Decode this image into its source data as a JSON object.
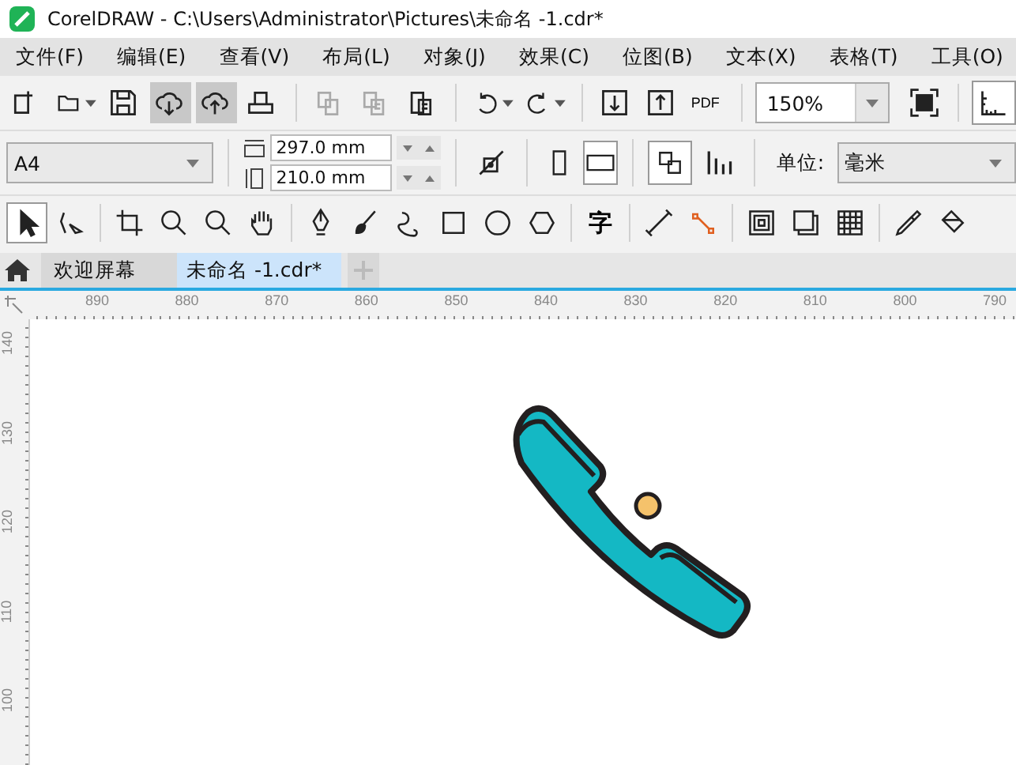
{
  "window": {
    "title": "CorelDRAW - C:\\Users\\Administrator\\Pictures\\未命名 -1.cdr*"
  },
  "menu": [
    "文件(F)",
    "编辑(E)",
    "查看(V)",
    "布局(L)",
    "对象(J)",
    "效果(C)",
    "位图(B)",
    "文本(X)",
    "表格(T)",
    "工具(O)"
  ],
  "standard_toolbar": {
    "buttons": [
      {
        "selected": false,
        "disabled": false
      },
      {
        "selected": false,
        "disabled": false
      },
      {
        "selected": false,
        "disabled": false
      },
      {
        "selected": true,
        "disabled": false
      },
      {
        "selected": true,
        "disabled": false
      },
      {
        "selected": false,
        "disabled": false
      },
      {
        "selected": false,
        "disabled": true
      },
      {
        "selected": false,
        "disabled": true
      },
      {
        "selected": false,
        "disabled": false
      },
      {
        "selected": false,
        "disabled": false
      },
      {
        "selected": false,
        "disabled": false
      },
      {
        "selected": false,
        "disabled": false
      },
      {
        "selected": false,
        "disabled": false
      }
    ],
    "pdf_label": "PDF",
    "zoom": "150%"
  },
  "property_bar": {
    "page_size": "A4",
    "width": "297.0 mm",
    "height": "210.0 mm",
    "portrait_selected": false,
    "landscape_selected": true,
    "unit_label": "单位:",
    "unit": "毫米"
  },
  "toolbox": {
    "text_tool": "字",
    "tools": [
      {
        "selected": true
      },
      {
        "selected": false
      },
      {
        "selected": false
      },
      {
        "selected": false
      },
      {
        "selected": false
      },
      {
        "selected": false
      },
      {
        "selected": false
      },
      {
        "selected": false
      },
      {
        "selected": false
      },
      {
        "selected": false
      },
      {
        "selected": false
      },
      {
        "selected": false
      }
    ]
  },
  "document_tabs": [
    {
      "kind": "home",
      "label": "欢迎屏幕",
      "selected": false
    },
    {
      "kind": "doc",
      "label": "未命名 -1.cdr*",
      "selected": true
    }
  ],
  "horizontal_ruler": [
    "890",
    "880",
    "870",
    "860",
    "850",
    "840",
    "830",
    "820",
    "810",
    "800",
    "790"
  ],
  "vertical_ruler": [
    "140",
    "130",
    "120",
    "110",
    "100"
  ]
}
